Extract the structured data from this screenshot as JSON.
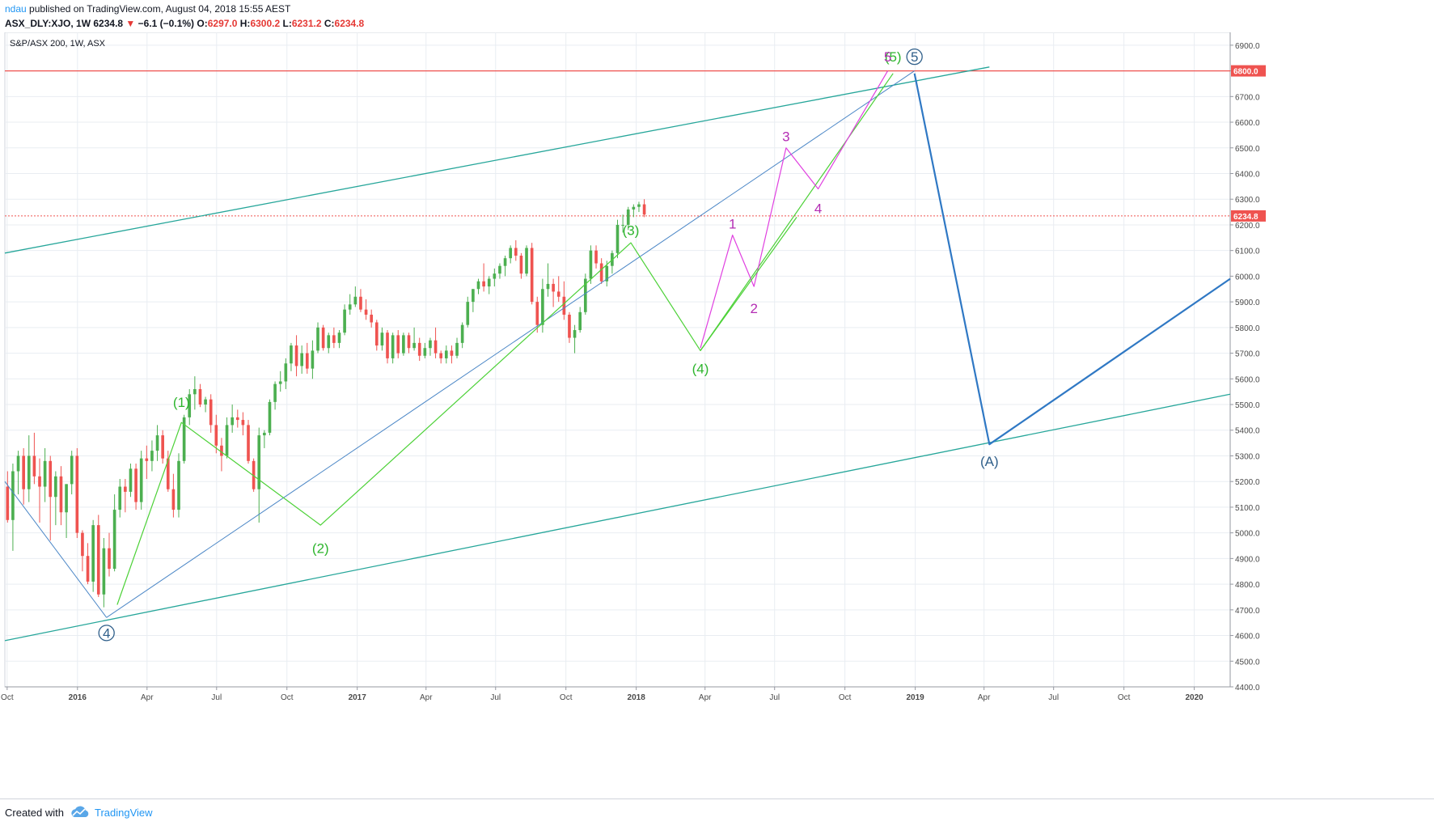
{
  "header": {
    "author": "ndau",
    "published_text": "published on TradingView.com, August 04, 2018 15:55 AEST",
    "symbol": "ASX_DLY:XJO, 1W",
    "last": "6234.8",
    "change": "−6.1 (−0.1%)",
    "open_label": "O:",
    "open": "6297.0",
    "high_label": "H:",
    "high": "6300.2",
    "low_label": "L:",
    "low": "6231.2",
    "close_label": "C:",
    "close": "6234.8"
  },
  "footer": {
    "created_with": "Created with",
    "brand": "TradingView"
  },
  "chart_data": {
    "type": "candlestick",
    "title": "S&P/ASX 200, 1W, ASX",
    "ylim": [
      4400,
      6950
    ],
    "xlim": [
      "2015-09-28",
      "2020-02-17"
    ],
    "yticks": [
      4400,
      4500,
      4600,
      4700,
      4800,
      4900,
      5000,
      5100,
      5200,
      5300,
      5400,
      5500,
      5600,
      5700,
      5800,
      5900,
      6000,
      6100,
      6200,
      6300,
      6400,
      6500,
      6600,
      6700,
      6800,
      6900
    ],
    "ytick_labels": [
      "4400.0",
      "4500.0",
      "4600.0",
      "4700.0",
      "4800.0",
      "4900.0",
      "5000.0",
      "5100.0",
      "5200.0",
      "5300.0",
      "5400.0",
      "5500.0",
      "5600.0",
      "5700.0",
      "5800.0",
      "5900.0",
      "6000.0",
      "6100.0",
      "6200.0",
      "6300.0",
      "6400.0",
      "6500.0",
      "6600.0",
      "6700.0",
      "6800.0",
      "6900.0"
    ],
    "xticks": [
      {
        "date": "2015-10-01",
        "label": "Oct",
        "bold": false
      },
      {
        "date": "2016-01-01",
        "label": "2016",
        "bold": true
      },
      {
        "date": "2016-04-01",
        "label": "Apr",
        "bold": false
      },
      {
        "date": "2016-07-01",
        "label": "Jul",
        "bold": false
      },
      {
        "date": "2016-10-01",
        "label": "Oct",
        "bold": false
      },
      {
        "date": "2017-01-01",
        "label": "2017",
        "bold": true
      },
      {
        "date": "2017-04-01",
        "label": "Apr",
        "bold": false
      },
      {
        "date": "2017-07-01",
        "label": "Jul",
        "bold": false
      },
      {
        "date": "2017-10-01",
        "label": "Oct",
        "bold": false
      },
      {
        "date": "2018-01-01",
        "label": "2018",
        "bold": true
      },
      {
        "date": "2018-04-01",
        "label": "Apr",
        "bold": false
      },
      {
        "date": "2018-07-01",
        "label": "Jul",
        "bold": false
      },
      {
        "date": "2018-10-01",
        "label": "Oct",
        "bold": false
      },
      {
        "date": "2019-01-01",
        "label": "2019",
        "bold": true
      },
      {
        "date": "2019-04-01",
        "label": "Apr",
        "bold": false
      },
      {
        "date": "2019-07-01",
        "label": "Jul",
        "bold": false
      },
      {
        "date": "2019-10-01",
        "label": "Oct",
        "bold": false
      },
      {
        "date": "2020-01-01",
        "label": "2020",
        "bold": true
      }
    ],
    "candles_start": "2015-09-28",
    "candles_interval_days": 7,
    "candles": [
      [
        5180,
        5240,
        5040,
        5050
      ],
      [
        5050,
        5270,
        4930,
        5240
      ],
      [
        5240,
        5320,
        5150,
        5300
      ],
      [
        5300,
        5330,
        5110,
        5170
      ],
      [
        5170,
        5380,
        5120,
        5300
      ],
      [
        5300,
        5390,
        5190,
        5220
      ],
      [
        5220,
        5290,
        5040,
        5180
      ],
      [
        5180,
        5330,
        5120,
        5280
      ],
      [
        5280,
        5300,
        4970,
        5140
      ],
      [
        5140,
        5240,
        5030,
        5220
      ],
      [
        5220,
        5260,
        5030,
        5080
      ],
      [
        5080,
        5190,
        4980,
        5190
      ],
      [
        5190,
        5320,
        5150,
        5300
      ],
      [
        5300,
        5330,
        4980,
        5000
      ],
      [
        5000,
        5010,
        4850,
        4910
      ],
      [
        4910,
        4960,
        4800,
        4810
      ],
      [
        4810,
        5050,
        4770,
        5030
      ],
      [
        5030,
        5070,
        4750,
        4760
      ],
      [
        4760,
        4980,
        4710,
        4940
      ],
      [
        4940,
        5000,
        4830,
        4860
      ],
      [
        4860,
        5150,
        4850,
        5090
      ],
      [
        5090,
        5210,
        5060,
        5180
      ],
      [
        5180,
        5210,
        5080,
        5160
      ],
      [
        5160,
        5270,
        5140,
        5250
      ],
      [
        5250,
        5270,
        5090,
        5120
      ],
      [
        5120,
        5320,
        5090,
        5290
      ],
      [
        5290,
        5340,
        5210,
        5280
      ],
      [
        5280,
        5360,
        5240,
        5320
      ],
      [
        5320,
        5420,
        5280,
        5380
      ],
      [
        5380,
        5400,
        5270,
        5290
      ],
      [
        5290,
        5320,
        5160,
        5170
      ],
      [
        5170,
        5230,
        5060,
        5090
      ],
      [
        5090,
        5310,
        5060,
        5280
      ],
      [
        5280,
        5460,
        5270,
        5450
      ],
      [
        5450,
        5560,
        5420,
        5540
      ],
      [
        5540,
        5610,
        5480,
        5560
      ],
      [
        5560,
        5580,
        5490,
        5500
      ],
      [
        5500,
        5530,
        5470,
        5520
      ],
      [
        5520,
        5540,
        5390,
        5420
      ],
      [
        5420,
        5460,
        5310,
        5340
      ],
      [
        5340,
        5370,
        5240,
        5300
      ],
      [
        5300,
        5450,
        5290,
        5420
      ],
      [
        5420,
        5500,
        5390,
        5450
      ],
      [
        5450,
        5480,
        5410,
        5440
      ],
      [
        5440,
        5470,
        5380,
        5420
      ],
      [
        5420,
        5440,
        5270,
        5280
      ],
      [
        5280,
        5290,
        5160,
        5170
      ],
      [
        5170,
        5410,
        5040,
        5380
      ],
      [
        5380,
        5400,
        5330,
        5390
      ],
      [
        5390,
        5520,
        5380,
        5510
      ],
      [
        5510,
        5590,
        5480,
        5580
      ],
      [
        5580,
        5630,
        5550,
        5590
      ],
      [
        5590,
        5680,
        5560,
        5660
      ],
      [
        5660,
        5740,
        5630,
        5730
      ],
      [
        5730,
        5770,
        5610,
        5650
      ],
      [
        5650,
        5730,
        5620,
        5700
      ],
      [
        5700,
        5740,
        5620,
        5640
      ],
      [
        5640,
        5750,
        5600,
        5710
      ],
      [
        5710,
        5820,
        5700,
        5800
      ],
      [
        5800,
        5810,
        5710,
        5720
      ],
      [
        5720,
        5780,
        5700,
        5770
      ],
      [
        5770,
        5800,
        5720,
        5740
      ],
      [
        5740,
        5790,
        5720,
        5780
      ],
      [
        5780,
        5890,
        5770,
        5870
      ],
      [
        5870,
        5930,
        5850,
        5890
      ],
      [
        5890,
        5960,
        5880,
        5920
      ],
      [
        5920,
        5950,
        5860,
        5870
      ],
      [
        5870,
        5910,
        5830,
        5850
      ],
      [
        5850,
        5870,
        5800,
        5820
      ],
      [
        5820,
        5830,
        5710,
        5730
      ],
      [
        5730,
        5800,
        5710,
        5780
      ],
      [
        5780,
        5790,
        5660,
        5680
      ],
      [
        5680,
        5780,
        5660,
        5770
      ],
      [
        5770,
        5790,
        5680,
        5700
      ],
      [
        5700,
        5780,
        5690,
        5770
      ],
      [
        5770,
        5780,
        5700,
        5720
      ],
      [
        5720,
        5800,
        5710,
        5740
      ],
      [
        5740,
        5760,
        5670,
        5690
      ],
      [
        5690,
        5740,
        5680,
        5720
      ],
      [
        5720,
        5760,
        5690,
        5750
      ],
      [
        5750,
        5800,
        5680,
        5700
      ],
      [
        5700,
        5710,
        5660,
        5680
      ],
      [
        5680,
        5730,
        5660,
        5710
      ],
      [
        5710,
        5730,
        5660,
        5690
      ],
      [
        5690,
        5760,
        5680,
        5740
      ],
      [
        5740,
        5820,
        5720,
        5810
      ],
      [
        5810,
        5920,
        5800,
        5900
      ],
      [
        5900,
        5950,
        5860,
        5950
      ],
      [
        5950,
        5990,
        5930,
        5980
      ],
      [
        5980,
        6050,
        5940,
        5960
      ],
      [
        5960,
        6000,
        5930,
        5990
      ],
      [
        5990,
        6030,
        5960,
        6010
      ],
      [
        6010,
        6050,
        5990,
        6040
      ],
      [
        6040,
        6080,
        6000,
        6070
      ],
      [
        6070,
        6120,
        6050,
        6110
      ],
      [
        6110,
        6140,
        6060,
        6080
      ],
      [
        6080,
        6090,
        5990,
        6010
      ],
      [
        6010,
        6120,
        6000,
        6110
      ],
      [
        6110,
        6130,
        5890,
        5900
      ],
      [
        5900,
        5920,
        5780,
        5810
      ],
      [
        5810,
        5990,
        5780,
        5950
      ],
      [
        5950,
        6050,
        5920,
        5970
      ],
      [
        5970,
        5990,
        5880,
        5940
      ],
      [
        5940,
        6000,
        5900,
        5920
      ],
      [
        5920,
        5980,
        5830,
        5850
      ],
      [
        5850,
        5860,
        5740,
        5760
      ],
      [
        5760,
        5810,
        5700,
        5790
      ],
      [
        5790,
        5880,
        5780,
        5860
      ],
      [
        5860,
        6010,
        5850,
        5990
      ],
      [
        5990,
        6120,
        5970,
        6100
      ],
      [
        6100,
        6120,
        6030,
        6050
      ],
      [
        6050,
        6070,
        5970,
        5980
      ],
      [
        5980,
        6060,
        5960,
        6040
      ],
      [
        6040,
        6100,
        6010,
        6090
      ],
      [
        6090,
        6220,
        6070,
        6200
      ],
      [
        6200,
        6240,
        6170,
        6200
      ],
      [
        6200,
        6270,
        6180,
        6260
      ],
      [
        6260,
        6280,
        6230,
        6270
      ],
      [
        6270,
        6290,
        6250,
        6280
      ],
      [
        6280,
        6300,
        6230,
        6240
      ]
    ],
    "price_lines": [
      {
        "name": "target",
        "value": 6800,
        "label": "6800.0",
        "style": "solid",
        "color": "#ef5350"
      },
      {
        "name": "last-price",
        "value": 6234.8,
        "label": "6234.8",
        "style": "dotted",
        "color": "#ef5350"
      }
    ],
    "drawings": [
      {
        "name": "upper-channel",
        "color": "#26a69a",
        "width": 1.3,
        "points": [
          [
            "2015-09-28",
            6090
          ],
          [
            "2019-04-08",
            6815
          ]
        ]
      },
      {
        "name": "lower-channel",
        "color": "#26a69a",
        "width": 1.3,
        "points": [
          [
            "2015-09-28",
            4580
          ],
          [
            "2020-02-17",
            5540
          ]
        ]
      },
      {
        "name": "trend-line-blue",
        "color": "#4a86c6",
        "width": 1,
        "points": [
          [
            "2016-02-08",
            4670
          ],
          [
            "2018-12-31",
            6800
          ]
        ]
      },
      {
        "name": "wave-4-leg",
        "color": "#4a86c6",
        "width": 1,
        "points": [
          [
            "2015-09-28",
            5200
          ],
          [
            "2016-02-08",
            4670
          ]
        ]
      },
      {
        "name": "primary-wave-path",
        "color": "#2f78c4",
        "width": 2.2,
        "points": [
          [
            "2018-12-31",
            6790
          ],
          [
            "2019-04-08",
            5345
          ],
          [
            "2020-02-17",
            5990
          ]
        ]
      },
      {
        "name": "intermediate-wave-path",
        "color": "#4cd137",
        "width": 1.2,
        "points": [
          [
            "2016-02-22",
            4720
          ],
          [
            "2016-05-16",
            5430
          ],
          [
            "2016-11-14",
            5030
          ],
          [
            "2017-12-25",
            6130
          ],
          [
            "2018-03-26",
            5710
          ],
          [
            "2018-12-03",
            6790
          ]
        ]
      },
      {
        "name": "minor-wave-path",
        "color": "#e040e0",
        "width": 1.2,
        "points": [
          [
            "2018-03-26",
            5720
          ],
          [
            "2018-05-07",
            6160
          ],
          [
            "2018-06-04",
            5960
          ],
          [
            "2018-07-16",
            6500
          ],
          [
            "2018-08-27",
            6340
          ],
          [
            "2018-11-26",
            6800
          ]
        ]
      },
      {
        "name": "wave-4-minor-leg",
        "color": "#4cd137",
        "width": 1.2,
        "points": [
          [
            "2018-03-26",
            5710
          ],
          [
            "2018-07-30",
            6230
          ]
        ]
      }
    ],
    "wave_labels": [
      {
        "text": "4",
        "date": "2016-02-08",
        "value": 4610,
        "color": "#2f5f8a",
        "circle": true
      },
      {
        "text": "(1)",
        "date": "2016-05-16",
        "value": 5510,
        "color": "#2db52d",
        "circle": false
      },
      {
        "text": "(2)",
        "date": "2016-11-14",
        "value": 4940,
        "color": "#2db52d",
        "circle": false
      },
      {
        "text": "(3)",
        "date": "2017-12-25",
        "value": 6180,
        "color": "#2db52d",
        "circle": false
      },
      {
        "text": "(4)",
        "date": "2018-03-26",
        "value": 5640,
        "color": "#2db52d",
        "circle": false
      },
      {
        "text": "(5)",
        "date": "2018-12-03",
        "value": 6855,
        "color": "#2db52d",
        "circle": false
      },
      {
        "text": "1",
        "date": "2018-05-07",
        "value": 6205,
        "color": "#b42db4",
        "circle": false
      },
      {
        "text": "2",
        "date": "2018-06-04",
        "value": 5875,
        "color": "#b42db4",
        "circle": false
      },
      {
        "text": "3",
        "date": "2018-07-16",
        "value": 6545,
        "color": "#b42db4",
        "circle": false
      },
      {
        "text": "4",
        "date": "2018-08-27",
        "value": 6265,
        "color": "#b42db4",
        "circle": false
      },
      {
        "text": "5",
        "date": "2018-11-26",
        "value": 6855,
        "color": "#b42db4",
        "circle": false
      },
      {
        "text": "5",
        "date": "2018-12-31",
        "value": 6855,
        "color": "#2f5f8a",
        "circle": true
      },
      {
        "text": "(A)",
        "date": "2019-04-08",
        "value": 5280,
        "color": "#2f5f8a",
        "circle": false
      }
    ],
    "colors": {
      "up": "#4caf50",
      "down": "#ef5350",
      "grid": "#e9edf2",
      "axis_text": "#4a4a4a"
    }
  }
}
